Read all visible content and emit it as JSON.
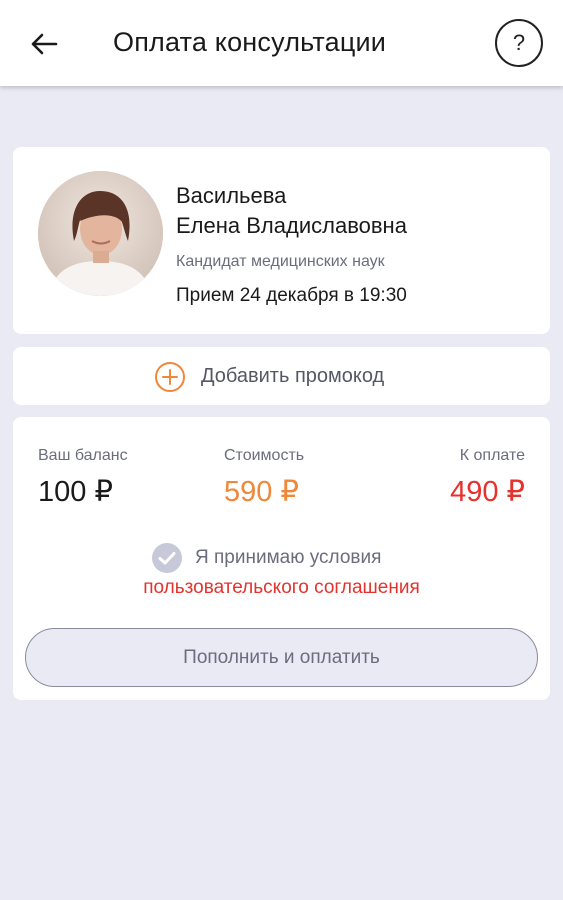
{
  "appbar": {
    "back_icon": "arrow-left-icon",
    "title": "Оплата консультации",
    "help_label": "?"
  },
  "doctor": {
    "avatar": "doctor-photo",
    "last_name": "Васильева",
    "first_middle_name": "Елена Владиславовна",
    "degree": "Кандидат медицинских наук",
    "appointment": "Прием 24 декабря в 19:30"
  },
  "promo": {
    "icon": "plus-circle-icon",
    "label": "Добавить промокод"
  },
  "payment": {
    "balance_label": "Ваш баланс",
    "balance_value": "100 ₽",
    "cost_label": "Стоимость",
    "cost_value": "590 ₽",
    "to_pay_label": "К оплате",
    "to_pay_value": "490 ₽",
    "agree_icon": "check-circle-icon",
    "agree_text": "Я принимаю условия",
    "agreement_link": "пользовательского соглашения",
    "pay_button": "Пополнить и оплатить"
  },
  "colors": {
    "background": "#e9eaf4",
    "accent_orange": "#f0883a",
    "accent_red": "#e5322d",
    "muted_text": "#6b6d7d"
  }
}
